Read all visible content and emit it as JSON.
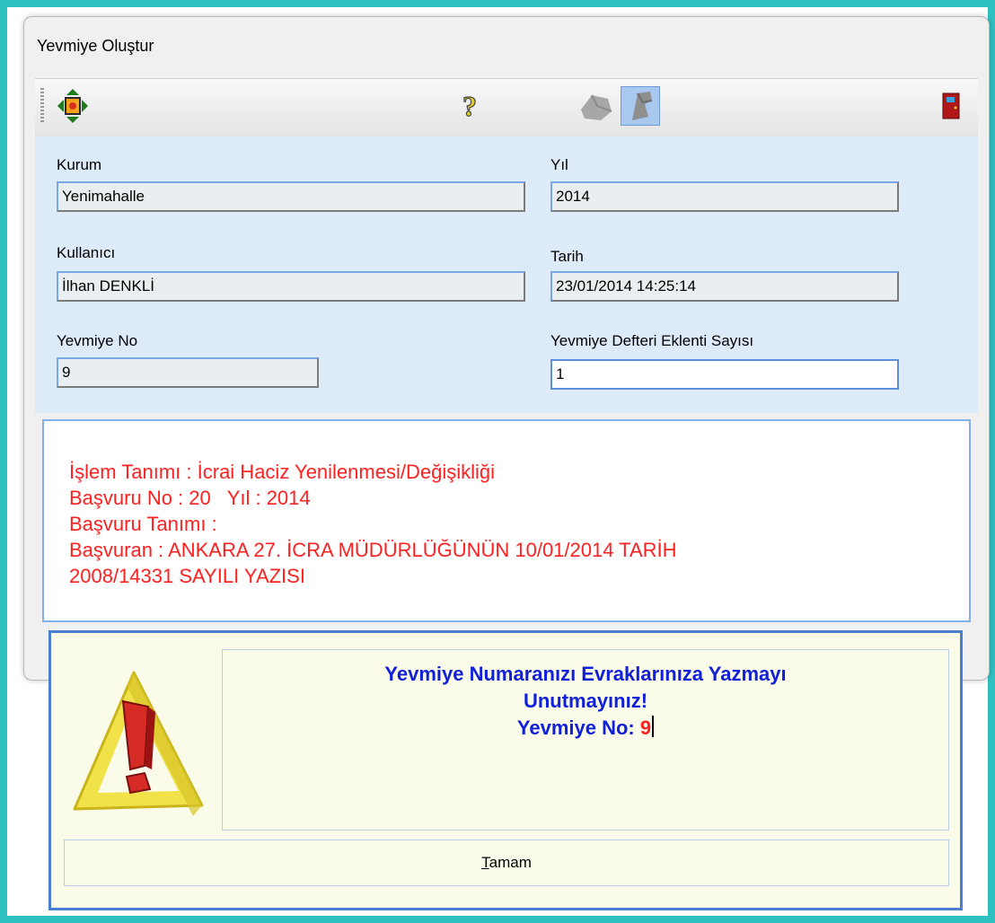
{
  "window": {
    "title": "Yevmiye Oluştur"
  },
  "toolbar": {
    "icons": [
      "navigate-icon",
      "help-icon",
      "disabled-tool-icon",
      "selected-tool-icon",
      "exit-door-icon"
    ]
  },
  "form": {
    "kurum_label": "Kurum",
    "kurum_value": "Yenimahalle",
    "yil_label": "Yıl",
    "yil_value": "2014",
    "kullanici_label": "Kullanıcı",
    "kullanici_value": "İlhan DENKLİ",
    "tarih_label": "Tarih",
    "tarih_value": "23/01/2014 14:25:14",
    "yevmiye_no_label": "Yevmiye No",
    "yevmiye_no_value": "9",
    "eklenti_label": "Yevmiye Defteri Eklenti Sayısı",
    "eklenti_value": "1"
  },
  "description": {
    "line1": "İşlem Tanımı : İcrai Haciz Yenilenmesi/Değişikliği",
    "line2": "Başvuru No : 20   Yıl : 2014",
    "line3": "Başvuru Tanımı :",
    "line4": "Başvuran : ANKARA 27. İCRA MÜDÜRLÜĞÜNÜN 10/01/2014 TARİH",
    "line5": "2008/14331 SAYILI YAZISI"
  },
  "dialog": {
    "message_line1": "Yevmiye Numaranızı Evraklarınıza Yazmayı",
    "message_line2": "Unutmayınız!",
    "message_prefix": "Yevmiye No: ",
    "message_number": "9",
    "ok_mnemonic": "T",
    "ok_rest": "amam"
  },
  "colors": {
    "accent_border": "#4a7fd0",
    "description_text": "#ff2020",
    "message_text": "#1020d8",
    "form_bg": "#ddeaf8"
  }
}
